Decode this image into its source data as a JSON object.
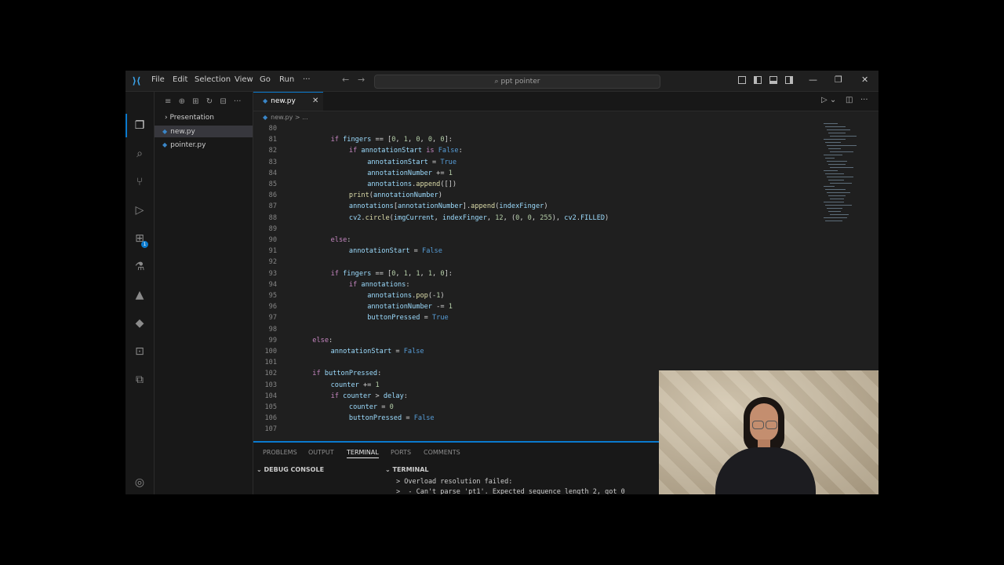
{
  "titlebar": {
    "menu": [
      "File",
      "Edit",
      "Selection",
      "View",
      "Go",
      "Run",
      "···"
    ],
    "search_text": "ppt pointer"
  },
  "activity_bar": {
    "icons": [
      "files-icon",
      "search-icon",
      "source-control-icon",
      "run-debug-icon",
      "extensions-icon",
      "testing-icon",
      "deploy-icon",
      "docker-icon",
      "remote-explorer-icon",
      "git-graph-icon",
      "account-icon"
    ],
    "extensions_badge": "1"
  },
  "explorer": {
    "items": [
      {
        "label": "Presentation",
        "type": "folder"
      },
      {
        "label": "new.py",
        "type": "file",
        "selected": true
      },
      {
        "label": "pointer.py",
        "type": "file",
        "selected": false
      }
    ]
  },
  "editor": {
    "tab_label": "new.py",
    "breadcrumb": "new.py > ...",
    "code_lines": [
      {
        "n": "80",
        "indent": 0,
        "tokens": []
      },
      {
        "n": "81",
        "indent": 2,
        "tokens": [
          [
            "kw",
            "if "
          ],
          [
            "var",
            "fingers"
          ],
          [
            "op",
            " == ["
          ],
          [
            "num",
            "0"
          ],
          [
            "op",
            ", "
          ],
          [
            "num",
            "1"
          ],
          [
            "op",
            ", "
          ],
          [
            "num",
            "0"
          ],
          [
            "op",
            ", "
          ],
          [
            "num",
            "0"
          ],
          [
            "op",
            ", "
          ],
          [
            "num",
            "0"
          ],
          [
            "op",
            "]:"
          ]
        ]
      },
      {
        "n": "82",
        "indent": 3,
        "tokens": [
          [
            "kw",
            "if "
          ],
          [
            "var",
            "annotationStart"
          ],
          [
            "kw",
            " is "
          ],
          [
            "bool",
            "False"
          ],
          [
            "op",
            ":"
          ]
        ]
      },
      {
        "n": "83",
        "indent": 4,
        "tokens": [
          [
            "var",
            "annotationStart"
          ],
          [
            "op",
            " = "
          ],
          [
            "bool",
            "True"
          ]
        ]
      },
      {
        "n": "84",
        "indent": 4,
        "tokens": [
          [
            "var",
            "annotationNumber"
          ],
          [
            "op",
            " += "
          ],
          [
            "num",
            "1"
          ]
        ]
      },
      {
        "n": "85",
        "indent": 4,
        "tokens": [
          [
            "var",
            "annotations"
          ],
          [
            "op",
            "."
          ],
          [
            "fn",
            "append"
          ],
          [
            "op",
            "([])"
          ]
        ]
      },
      {
        "n": "86",
        "indent": 3,
        "tokens": [
          [
            "fn",
            "print"
          ],
          [
            "op",
            "("
          ],
          [
            "var",
            "annotationNumber"
          ],
          [
            "op",
            ")"
          ]
        ]
      },
      {
        "n": "87",
        "indent": 3,
        "tokens": [
          [
            "var",
            "annotations"
          ],
          [
            "op",
            "["
          ],
          [
            "var",
            "annotationNumber"
          ],
          [
            "op",
            "]."
          ],
          [
            "fn",
            "append"
          ],
          [
            "op",
            "("
          ],
          [
            "var",
            "indexFinger"
          ],
          [
            "op",
            ")"
          ]
        ]
      },
      {
        "n": "88",
        "indent": 3,
        "tokens": [
          [
            "var",
            "cv2"
          ],
          [
            "op",
            "."
          ],
          [
            "fn",
            "circle"
          ],
          [
            "op",
            "("
          ],
          [
            "var",
            "imgCurrent"
          ],
          [
            "op",
            ", "
          ],
          [
            "var",
            "indexFinger"
          ],
          [
            "op",
            ", "
          ],
          [
            "num",
            "12"
          ],
          [
            "op",
            ", ("
          ],
          [
            "num",
            "0"
          ],
          [
            "op",
            ", "
          ],
          [
            "num",
            "0"
          ],
          [
            "op",
            ", "
          ],
          [
            "num",
            "255"
          ],
          [
            "op",
            "), "
          ],
          [
            "var",
            "cv2"
          ],
          [
            "op",
            "."
          ],
          [
            "var",
            "FILLED"
          ],
          [
            "op",
            ")"
          ]
        ]
      },
      {
        "n": "89",
        "indent": 0,
        "tokens": []
      },
      {
        "n": "90",
        "indent": 2,
        "tokens": [
          [
            "kw",
            "else"
          ],
          [
            "op",
            ":"
          ]
        ]
      },
      {
        "n": "91",
        "indent": 3,
        "tokens": [
          [
            "var",
            "annotationStart"
          ],
          [
            "op",
            " = "
          ],
          [
            "bool",
            "False"
          ]
        ]
      },
      {
        "n": "92",
        "indent": 0,
        "tokens": []
      },
      {
        "n": "93",
        "indent": 2,
        "tokens": [
          [
            "kw",
            "if "
          ],
          [
            "var",
            "fingers"
          ],
          [
            "op",
            " == ["
          ],
          [
            "num",
            "0"
          ],
          [
            "op",
            ", "
          ],
          [
            "num",
            "1"
          ],
          [
            "op",
            ", "
          ],
          [
            "num",
            "1"
          ],
          [
            "op",
            ", "
          ],
          [
            "num",
            "1"
          ],
          [
            "op",
            ", "
          ],
          [
            "num",
            "0"
          ],
          [
            "op",
            "]:"
          ]
        ]
      },
      {
        "n": "94",
        "indent": 3,
        "tokens": [
          [
            "kw",
            "if "
          ],
          [
            "var",
            "annotations"
          ],
          [
            "op",
            ":"
          ]
        ]
      },
      {
        "n": "95",
        "indent": 4,
        "tokens": [
          [
            "var",
            "annotations"
          ],
          [
            "op",
            "."
          ],
          [
            "fn",
            "pop"
          ],
          [
            "op",
            "(-"
          ],
          [
            "num",
            "1"
          ],
          [
            "op",
            ")"
          ]
        ]
      },
      {
        "n": "96",
        "indent": 4,
        "tokens": [
          [
            "var",
            "annotationNumber"
          ],
          [
            "op",
            " -= "
          ],
          [
            "num",
            "1"
          ]
        ]
      },
      {
        "n": "97",
        "indent": 4,
        "tokens": [
          [
            "var",
            "buttonPressed"
          ],
          [
            "op",
            " = "
          ],
          [
            "bool",
            "True"
          ]
        ]
      },
      {
        "n": "98",
        "indent": 0,
        "tokens": []
      },
      {
        "n": "99",
        "indent": 1,
        "tokens": [
          [
            "kw",
            "else"
          ],
          [
            "op",
            ":"
          ]
        ]
      },
      {
        "n": "100",
        "indent": 2,
        "tokens": [
          [
            "var",
            "annotationStart"
          ],
          [
            "op",
            " = "
          ],
          [
            "bool",
            "False"
          ]
        ]
      },
      {
        "n": "101",
        "indent": 0,
        "tokens": []
      },
      {
        "n": "102",
        "indent": 1,
        "tokens": [
          [
            "kw",
            "if "
          ],
          [
            "var",
            "buttonPressed"
          ],
          [
            "op",
            ":"
          ]
        ]
      },
      {
        "n": "103",
        "indent": 2,
        "tokens": [
          [
            "var",
            "counter"
          ],
          [
            "op",
            " += "
          ],
          [
            "num",
            "1"
          ]
        ]
      },
      {
        "n": "104",
        "indent": 2,
        "tokens": [
          [
            "kw",
            "if "
          ],
          [
            "var",
            "counter"
          ],
          [
            "op",
            " > "
          ],
          [
            "var",
            "delay"
          ],
          [
            "op",
            ":"
          ]
        ]
      },
      {
        "n": "105",
        "indent": 3,
        "tokens": [
          [
            "var",
            "counter"
          ],
          [
            "op",
            " = "
          ],
          [
            "num",
            "0"
          ]
        ]
      },
      {
        "n": "106",
        "indent": 3,
        "tokens": [
          [
            "var",
            "buttonPressed"
          ],
          [
            "op",
            " = "
          ],
          [
            "bool",
            "False"
          ]
        ]
      },
      {
        "n": "107",
        "indent": 0,
        "tokens": []
      }
    ]
  },
  "panel": {
    "tabs": [
      "PROBLEMS",
      "OUTPUT",
      "TERMINAL",
      "PORTS",
      "COMMENTS"
    ],
    "active_tab": "TERMINAL",
    "debug_console_label": "DEBUG CONSOLE",
    "terminal_label": "TERMINAL",
    "terminal_lines": [
      "> Overload resolution failed:",
      ">  - Can't parse 'pt1'. Expected sequence length 2, got 0"
    ]
  },
  "colors": {
    "accent": "#0a7ace",
    "editor_bg": "#1f1f1f",
    "keyword": "#c586c0",
    "variable": "#9cdcfe",
    "number": "#b5cea8",
    "function": "#dcdcaa",
    "boolean": "#569cd6"
  }
}
